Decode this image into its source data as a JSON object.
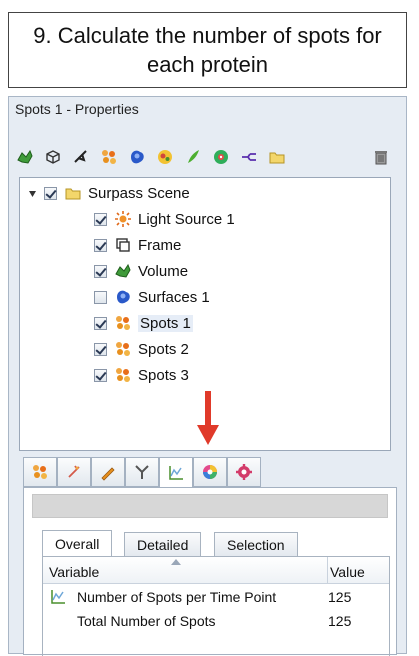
{
  "step": {
    "text": "9. Calculate the number of spots for each protein"
  },
  "panel": {
    "title": "Spots 1 - Properties"
  },
  "toolbar": {
    "icons": [
      "volume-icon",
      "frame-icon",
      "light-source-icon",
      "spots-icon",
      "surfaces-icon",
      "cells-icon",
      "filaments-icon",
      "reference-frame-icon",
      "measurement-icon",
      "folder-icon",
      "trash-icon"
    ]
  },
  "tree": {
    "root": {
      "label": "Surpass Scene",
      "checked": true,
      "icon": "folder-icon"
    },
    "items": [
      {
        "label": "Light Source 1",
        "checked": true,
        "icon": "light-source-icon"
      },
      {
        "label": "Frame",
        "checked": true,
        "icon": "frame-icon"
      },
      {
        "label": "Volume",
        "checked": true,
        "icon": "volume-icon"
      },
      {
        "label": "Surfaces 1",
        "checked": false,
        "icon": "surfaces-icon"
      },
      {
        "label": "Spots 1",
        "checked": true,
        "icon": "spots-icon",
        "selected": true
      },
      {
        "label": "Spots 2",
        "checked": true,
        "icon": "spots-icon"
      },
      {
        "label": "Spots 3",
        "checked": true,
        "icon": "spots-icon"
      }
    ]
  },
  "tabs": {
    "icons": [
      "spots-icon",
      "edit-icon",
      "pencil-icon",
      "filter-icon",
      "statistics-icon",
      "color-icon",
      "settings-icon"
    ],
    "active_index": 4
  },
  "stats": {
    "subtabs": [
      "Overall",
      "Detailed",
      "Selection"
    ],
    "active_subtab": 0,
    "columns": {
      "variable": "Variable",
      "value": "Value"
    },
    "rows": [
      {
        "variable": "Number of Spots per Time Point",
        "value": "125"
      },
      {
        "variable": "Total Number of Spots",
        "value": "125"
      }
    ]
  },
  "colors": {
    "accent_arrow": "#e03a2a",
    "panel_bg": "#e6ecf3"
  }
}
